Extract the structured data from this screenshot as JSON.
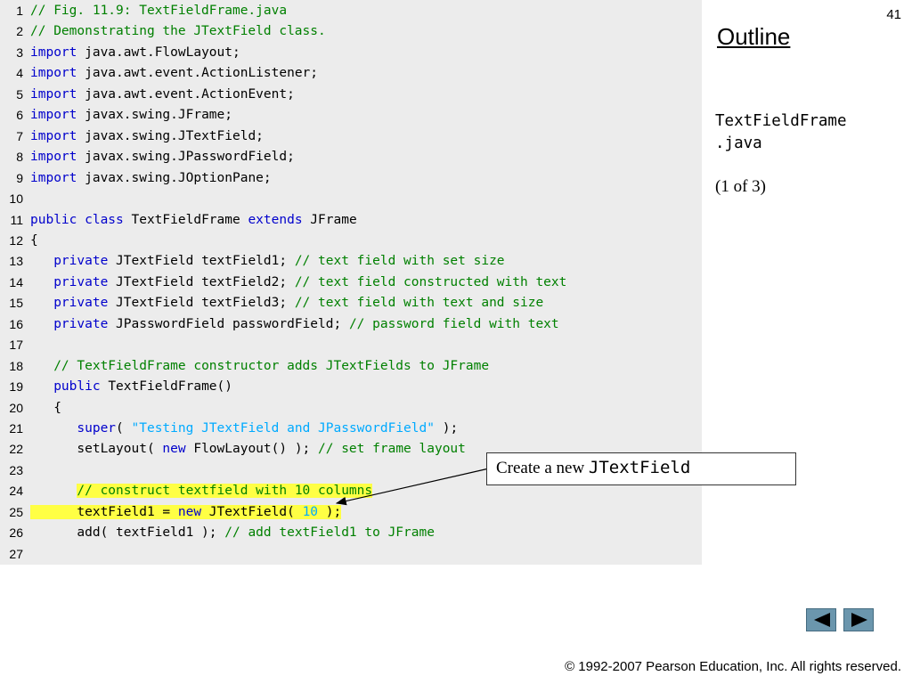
{
  "slide": {
    "number": "41",
    "outline_title": "Outline",
    "file_name": "TextFieldFrame\n.java",
    "page_of": "(1 of 3)",
    "copyright": "© 1992-2007 Pearson Education, Inc.  All rights reserved."
  },
  "callout": {
    "text": "Create a new ",
    "code": "JTextField"
  },
  "nav": {
    "prev_icon": "triangle-left-icon",
    "next_icon": "triangle-right-icon"
  },
  "colors": {
    "keyword": "#0000cc",
    "comment": "#008000",
    "string": "#00aaff",
    "highlight": "#ffff44",
    "panel": "#ececec",
    "nav": "#6b96ad"
  },
  "code_lines": [
    {
      "n": "1",
      "hl": false,
      "tokens": [
        [
          "comment",
          "// Fig. 11.9: TextFieldFrame.java"
        ]
      ]
    },
    {
      "n": "2",
      "hl": false,
      "tokens": [
        [
          "comment",
          "// Demonstrating the JTextField class."
        ]
      ]
    },
    {
      "n": "3",
      "hl": false,
      "tokens": [
        [
          "keyword",
          "import"
        ],
        [
          "normal",
          " java.awt.FlowLayout;"
        ]
      ]
    },
    {
      "n": "4",
      "hl": false,
      "tokens": [
        [
          "keyword",
          "import"
        ],
        [
          "normal",
          " java.awt.event.ActionListener;"
        ]
      ]
    },
    {
      "n": "5",
      "hl": false,
      "tokens": [
        [
          "keyword",
          "import"
        ],
        [
          "normal",
          " java.awt.event.ActionEvent;"
        ]
      ]
    },
    {
      "n": "6",
      "hl": false,
      "tokens": [
        [
          "keyword",
          "import"
        ],
        [
          "normal",
          " javax.swing.JFrame;"
        ]
      ]
    },
    {
      "n": "7",
      "hl": false,
      "tokens": [
        [
          "keyword",
          "import"
        ],
        [
          "normal",
          " javax.swing.JTextField;"
        ]
      ]
    },
    {
      "n": "8",
      "hl": false,
      "tokens": [
        [
          "keyword",
          "import"
        ],
        [
          "normal",
          " javax.swing.JPasswordField;"
        ]
      ]
    },
    {
      "n": "9",
      "hl": false,
      "tokens": [
        [
          "keyword",
          "import"
        ],
        [
          "normal",
          " javax.swing.JOptionPane;"
        ]
      ]
    },
    {
      "n": "10",
      "hl": false,
      "tokens": []
    },
    {
      "n": "11",
      "hl": false,
      "tokens": [
        [
          "keyword",
          "public class"
        ],
        [
          "normal",
          " TextFieldFrame "
        ],
        [
          "keyword",
          "extends"
        ],
        [
          "normal",
          " JFrame"
        ]
      ]
    },
    {
      "n": "12",
      "hl": false,
      "tokens": [
        [
          "normal",
          "{"
        ]
      ]
    },
    {
      "n": "13",
      "hl": false,
      "tokens": [
        [
          "normal",
          "   "
        ],
        [
          "keyword",
          "private"
        ],
        [
          "normal",
          " JTextField textField1; "
        ],
        [
          "comment",
          "// text field with set size"
        ]
      ]
    },
    {
      "n": "14",
      "hl": false,
      "tokens": [
        [
          "normal",
          "   "
        ],
        [
          "keyword",
          "private"
        ],
        [
          "normal",
          " JTextField textField2; "
        ],
        [
          "comment",
          "// text field constructed with text"
        ]
      ]
    },
    {
      "n": "15",
      "hl": false,
      "tokens": [
        [
          "normal",
          "   "
        ],
        [
          "keyword",
          "private"
        ],
        [
          "normal",
          " JTextField textField3; "
        ],
        [
          "comment",
          "// text field with text and size"
        ]
      ]
    },
    {
      "n": "16",
      "hl": false,
      "tokens": [
        [
          "normal",
          "   "
        ],
        [
          "keyword",
          "private"
        ],
        [
          "normal",
          " JPasswordField passwordField; "
        ],
        [
          "comment",
          "// password field with text"
        ]
      ]
    },
    {
      "n": "17",
      "hl": false,
      "tokens": []
    },
    {
      "n": "18",
      "hl": false,
      "tokens": [
        [
          "normal",
          "   "
        ],
        [
          "comment",
          "// TextFieldFrame constructor adds JTextFields to JFrame"
        ]
      ]
    },
    {
      "n": "19",
      "hl": false,
      "tokens": [
        [
          "normal",
          "   "
        ],
        [
          "keyword",
          "public"
        ],
        [
          "normal",
          " TextFieldFrame()"
        ]
      ]
    },
    {
      "n": "20",
      "hl": false,
      "tokens": [
        [
          "normal",
          "   {"
        ]
      ]
    },
    {
      "n": "21",
      "hl": false,
      "tokens": [
        [
          "normal",
          "      "
        ],
        [
          "keyword",
          "super"
        ],
        [
          "normal",
          "( "
        ],
        [
          "string",
          "\"Testing JTextField and JPasswordField\""
        ],
        [
          "normal",
          " );"
        ]
      ]
    },
    {
      "n": "22",
      "hl": false,
      "tokens": [
        [
          "normal",
          "      setLayout( "
        ],
        [
          "keyword",
          "new"
        ],
        [
          "normal",
          " FlowLayout() ); "
        ],
        [
          "comment",
          "// set frame layout"
        ]
      ]
    },
    {
      "n": "23",
      "hl": false,
      "tokens": []
    },
    {
      "n": "24",
      "hl": true,
      "tokens": [
        [
          "normal",
          "      "
        ],
        [
          "comment",
          "// construct textfield with 10 columns"
        ]
      ]
    },
    {
      "n": "25",
      "hl": true,
      "tokens": [
        [
          "normal",
          "      textField1 = "
        ],
        [
          "keyword",
          "new"
        ],
        [
          "normal",
          " JTextField( "
        ],
        [
          "number",
          "10"
        ],
        [
          "normal",
          " );"
        ]
      ]
    },
    {
      "n": "26",
      "hl": false,
      "tokens": [
        [
          "normal",
          "      add( textField1 ); "
        ],
        [
          "comment",
          "// add textField1 to JFrame"
        ]
      ]
    },
    {
      "n": "27",
      "hl": false,
      "tokens": []
    }
  ]
}
